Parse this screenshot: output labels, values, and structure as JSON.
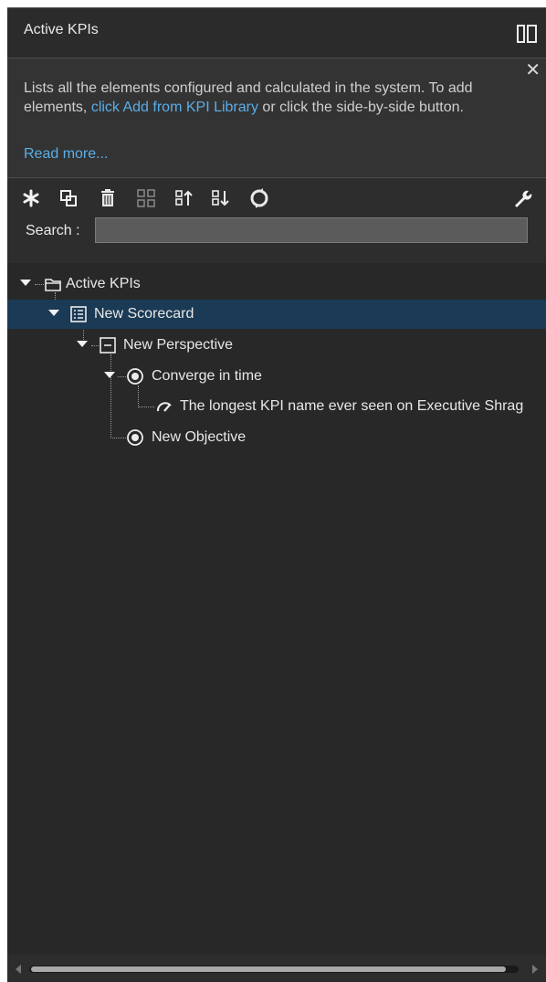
{
  "header": {
    "title": "Active KPIs",
    "layout_icon": "side-by-side-icon"
  },
  "info": {
    "text_before": "Lists all the elements configured and calculated in the system. To add elements, ",
    "link_text": "click Add from KPI Library",
    "text_after": " or click the side-by-side button.",
    "read_more": "Read more...",
    "close_symbol": "✕"
  },
  "toolbar": {
    "icons": [
      "new-icon",
      "copy-icon",
      "delete-icon",
      "group-icon",
      "move-up-icon",
      "move-down-icon",
      "refresh-icon",
      "settings-wrench-icon"
    ]
  },
  "search": {
    "label": "Search :",
    "value": "",
    "placeholder": ""
  },
  "tree": {
    "items": [
      {
        "label": "Active KPIs",
        "icon": "folder-icon",
        "level": 0,
        "expanded": true,
        "selected": false
      },
      {
        "label": "New Scorecard",
        "icon": "scorecard-icon",
        "level": 1,
        "expanded": true,
        "selected": true
      },
      {
        "label": "New Perspective",
        "icon": "perspective-icon",
        "level": 2,
        "expanded": true,
        "selected": false
      },
      {
        "label": "Converge in time",
        "icon": "objective-icon",
        "level": 3,
        "expanded": true,
        "selected": false
      },
      {
        "label": "The longest KPI name ever seen on Executive Shrag",
        "icon": "kpi-gauge-icon",
        "level": 4,
        "expanded": false,
        "selected": false
      },
      {
        "label": "New Objective",
        "icon": "objective-icon",
        "level": 3,
        "expanded": false,
        "selected": false
      }
    ]
  },
  "colors": {
    "panel_bg": "#2d2d2d",
    "selected_row": "#1b3a55",
    "link": "#5aaee8"
  }
}
